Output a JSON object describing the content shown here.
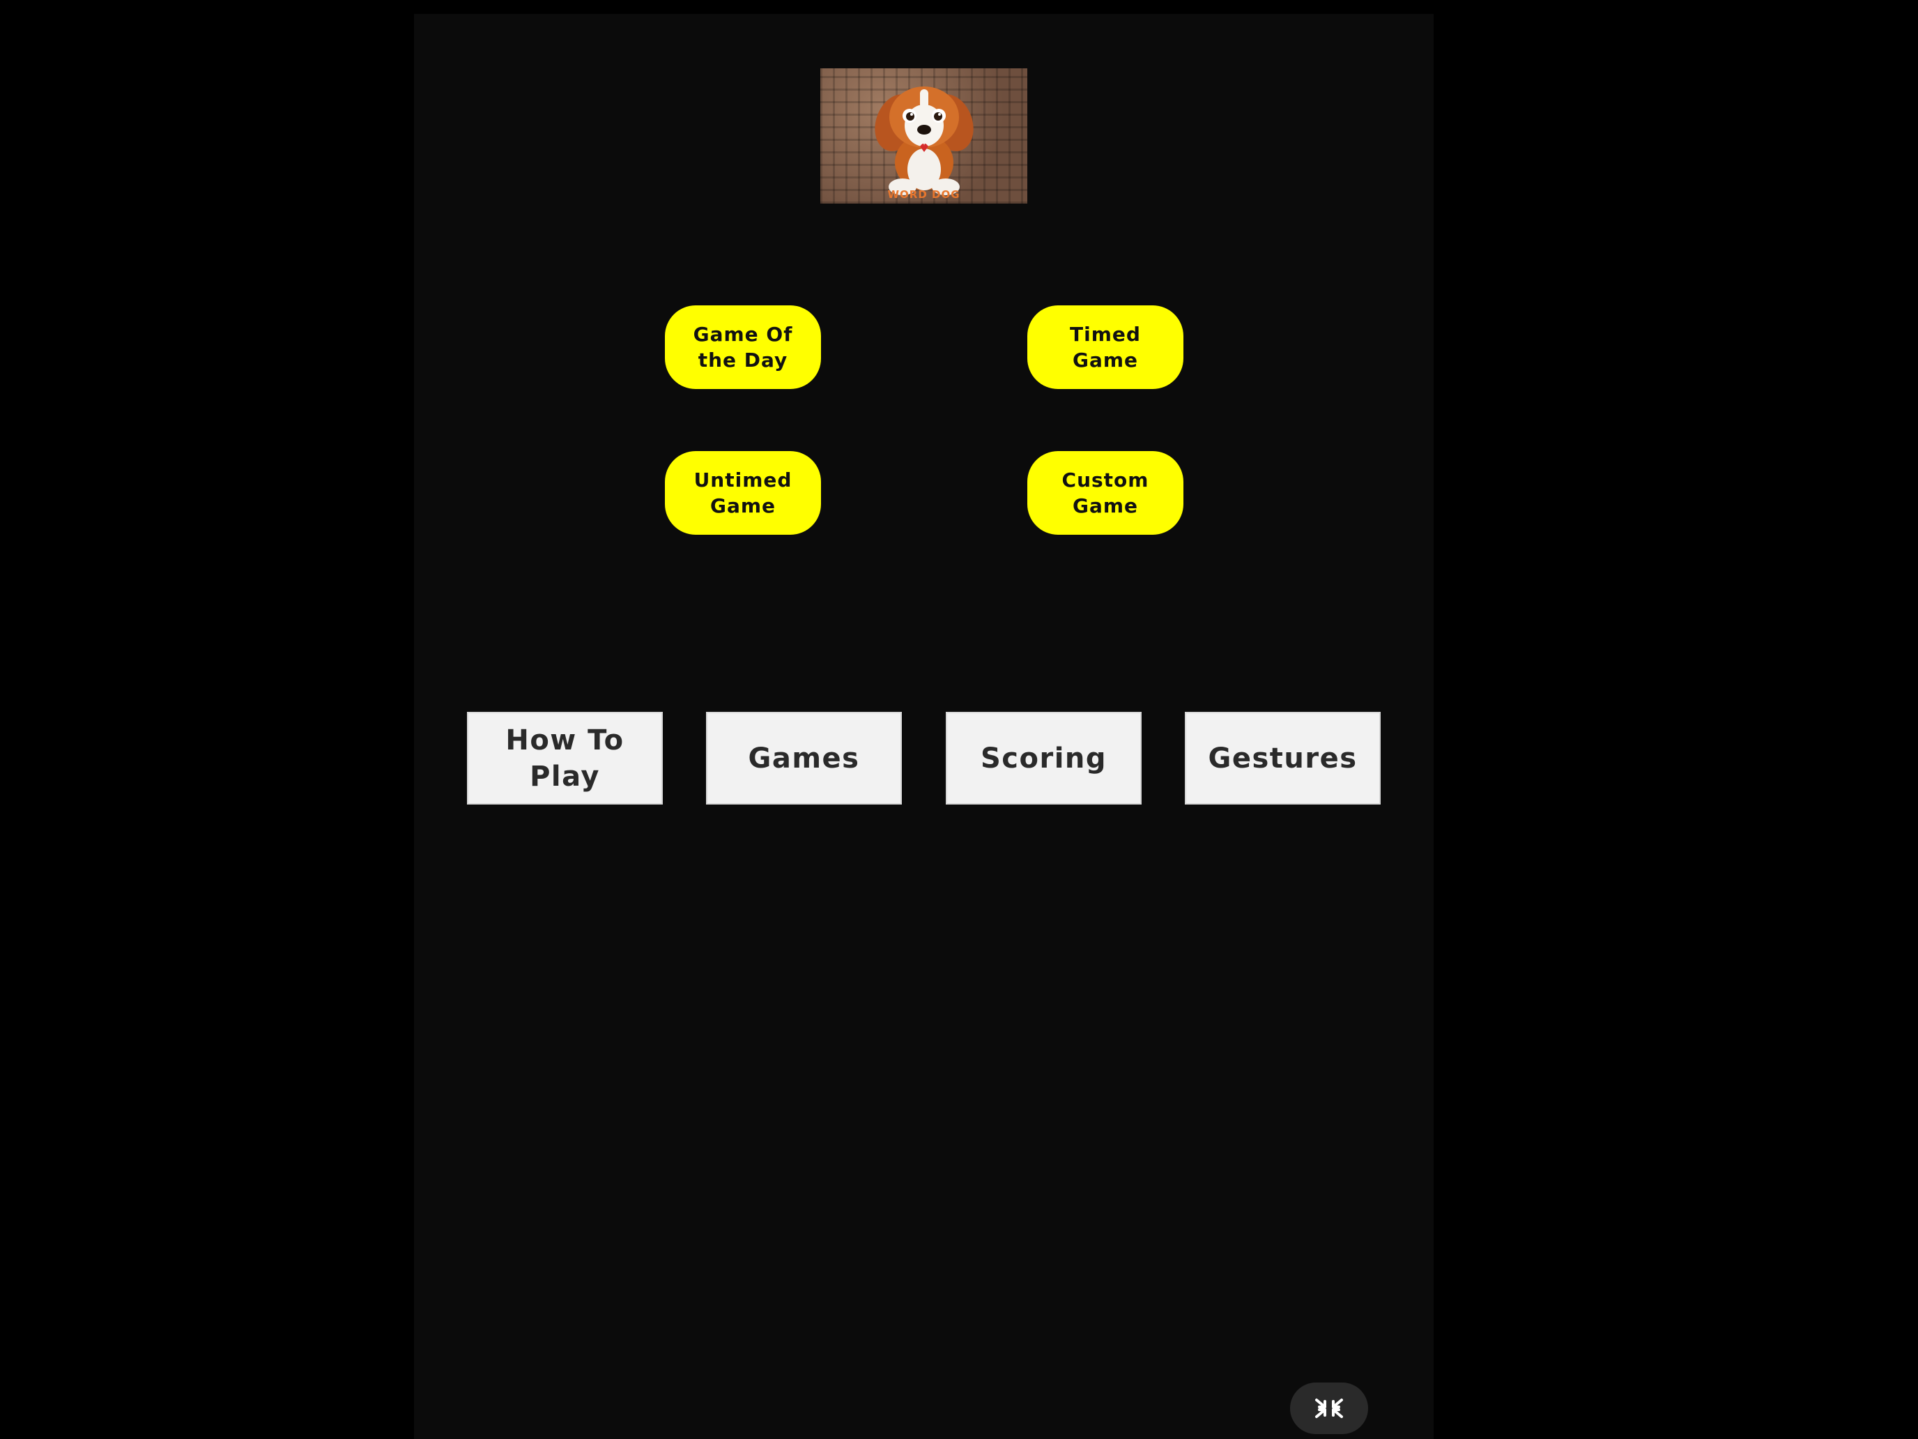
{
  "logo": {
    "alt_icon": "cartoon-dog-logo",
    "caption": "WORD DOG"
  },
  "mode_buttons": {
    "game_of_the_day": "Game Of the Day",
    "timed_game": "Timed Game",
    "untimed_game": "Untimed Game",
    "custom_game": "Custom Game"
  },
  "info_buttons": {
    "how_to_play": "How To Play",
    "games": "Games",
    "scoring": "Scoring",
    "gestures": "Gestures"
  },
  "controls": {
    "exit_fullscreen_icon": "collapse-arrows-icon"
  },
  "colors": {
    "background": "#000000",
    "panel": "#0b0b0b",
    "mode_button": "#ffff00",
    "info_button": "#f2f2f2"
  }
}
